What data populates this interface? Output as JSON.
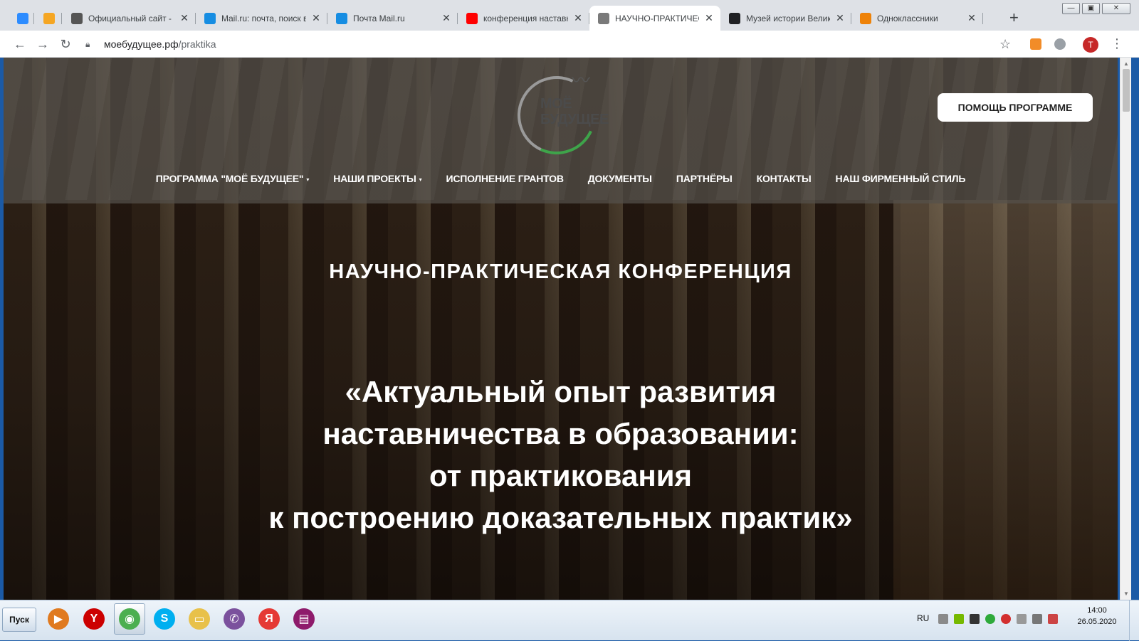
{
  "browser": {
    "tabs": [
      {
        "title": "",
        "favicon": "zoom-icon",
        "color": "#2d8cff"
      },
      {
        "title": "",
        "favicon": "yandex-browser-icon",
        "color": "#f5a623"
      },
      {
        "title": "Официальный сайт - Гла",
        "favicon": "feather-icon",
        "color": "#555555"
      },
      {
        "title": "Mail.ru: почта, поиск в и",
        "favicon": "mailru-icon",
        "color": "#168de2"
      },
      {
        "title": "Почта Mail.ru",
        "favicon": "mail-envelope-icon",
        "color": "#168de2"
      },
      {
        "title": "конференция наставнич",
        "favicon": "yandex-icon",
        "color": "#ff0000"
      },
      {
        "title": "НАУЧНО-ПРАКТИЧЕСКАЯ",
        "favicon": "site-logo-icon",
        "color": "#7a7a7a",
        "active": true
      },
      {
        "title": "Музей истории Великой",
        "favicon": "plus-square-icon",
        "color": "#202124"
      },
      {
        "title": "Одноклассники",
        "favicon": "odnoklassniki-icon",
        "color": "#ee8208"
      }
    ],
    "new_tab": "+",
    "url_host": "моебудущее.рф",
    "url_path": "/praktika"
  },
  "site": {
    "logo_line1": "МОЁ",
    "logo_line2": "БУДУЩЕЕ",
    "help_button": "ПОМОЩЬ ПРОГРАММЕ",
    "nav": [
      {
        "label": "ПРОГРАММА \"МОЁ БУДУЩЕЕ\"",
        "dropdown": true
      },
      {
        "label": "НАШИ ПРОЕКТЫ",
        "dropdown": true
      },
      {
        "label": "ИСПОЛНЕНИЕ ГРАНТОВ",
        "dropdown": false
      },
      {
        "label": "ДОКУМЕНТЫ",
        "dropdown": false
      },
      {
        "label": "ПАРТНЁРЫ",
        "dropdown": false
      },
      {
        "label": "КОНТАКТЫ",
        "dropdown": false
      },
      {
        "label": "НАШ ФИРМЕННЫЙ СТИЛЬ",
        "dropdown": false
      }
    ],
    "hero_kicker": "НАУЧНО-ПРАКТИЧЕСКАЯ КОНФЕРЕНЦИЯ",
    "hero_title_lines": [
      "«Актуальный опыт развития",
      "наставничества в образовании:",
      "от практикования",
      "к построению доказательных практик»"
    ]
  },
  "taskbar": {
    "start_label": "Пуск",
    "apps": [
      {
        "name": "media-player-icon",
        "color": "#e07a1f",
        "glyph": "▶"
      },
      {
        "name": "yandex-browser-icon",
        "color": "#cc0000",
        "glyph": "Y"
      },
      {
        "name": "chrome-icon",
        "color": "#4caf50",
        "glyph": "◉",
        "active": true
      },
      {
        "name": "skype-icon",
        "color": "#00aff0",
        "glyph": "S"
      },
      {
        "name": "folder-icon",
        "color": "#e8c14a",
        "glyph": "▭"
      },
      {
        "name": "viber-icon",
        "color": "#7b519d",
        "glyph": "✆"
      },
      {
        "name": "yandex-icon",
        "color": "#e53935",
        "glyph": "Я"
      },
      {
        "name": "winrar-icon",
        "color": "#8e1b6b",
        "glyph": "▤"
      }
    ],
    "language": "RU",
    "time": "14:00",
    "date": "26.05.2020"
  }
}
